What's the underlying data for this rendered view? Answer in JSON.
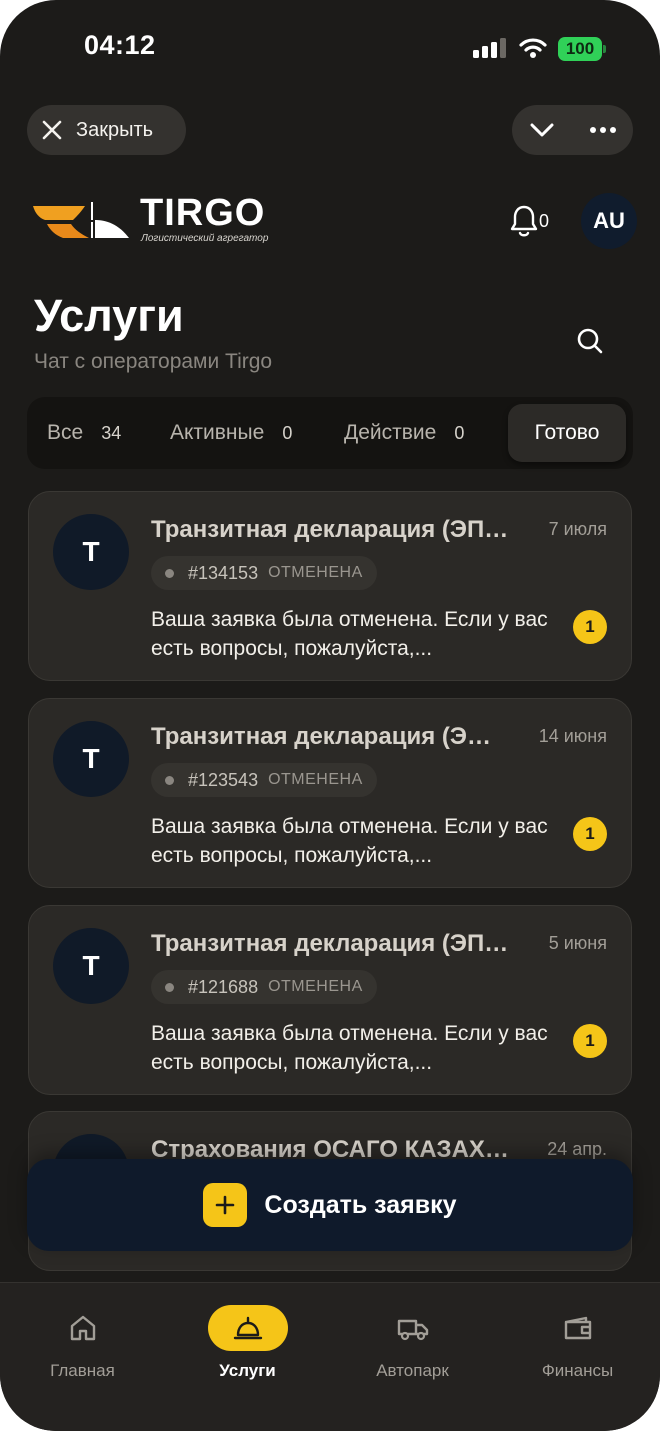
{
  "status_bar": {
    "time": "04:12",
    "battery": "100"
  },
  "top_bar": {
    "close_label": "Закрыть"
  },
  "brand": {
    "name": "TIRGO",
    "tagline": "Логистический агрегатор"
  },
  "header": {
    "notifications_count": "0",
    "avatar_initials": "AU"
  },
  "page": {
    "title": "Услуги",
    "subtitle": "Чат с операторами Tirgo"
  },
  "tabs": [
    {
      "label": "Все",
      "count": "34"
    },
    {
      "label": "Активные",
      "count": "0"
    },
    {
      "label": "Действие",
      "count": "0"
    },
    {
      "label": "Готово",
      "active": true
    }
  ],
  "requests": [
    {
      "avatar": "T",
      "title": "Транзитная декларация (ЭП…",
      "date": "7 июля",
      "id": "#134153",
      "status": "ОТМЕНЕНА",
      "message": "Ваша заявка была отменена. Если у вас есть вопросы, пожалуйста,...",
      "unread": "1"
    },
    {
      "avatar": "T",
      "title": "Транзитная декларация (Э…",
      "date": "14 июня",
      "id": "#123543",
      "status": "ОТМЕНЕНА",
      "message": "Ваша заявка была отменена. Если у вас есть вопросы, пожалуйста,...",
      "unread": "1"
    },
    {
      "avatar": "T",
      "title": "Транзитная декларация (ЭП…",
      "date": "5 июня",
      "id": "#121688",
      "status": "ОТМЕНЕНА",
      "message": "Ваша заявка была отменена. Если у вас есть вопросы, пожалуйста,...",
      "unread": "1"
    },
    {
      "avatar": "",
      "title": "Страхования ОСАГО КАЗАХ…",
      "date": "24 апр."
    }
  ],
  "create_button": {
    "label": "Создать заявку"
  },
  "bottom_nav": [
    {
      "label": "Главная",
      "icon": "home-icon"
    },
    {
      "label": "Услуги",
      "icon": "service-bell-icon",
      "active": true
    },
    {
      "label": "Автопарк",
      "icon": "truck-icon"
    },
    {
      "label": "Финансы",
      "icon": "wallet-icon"
    }
  ],
  "colors": {
    "accent": "#f5c518",
    "background": "#1c1b19",
    "card": "#2b2926",
    "navy": "#0f1a2b",
    "brand_orange": "#f0a020"
  }
}
